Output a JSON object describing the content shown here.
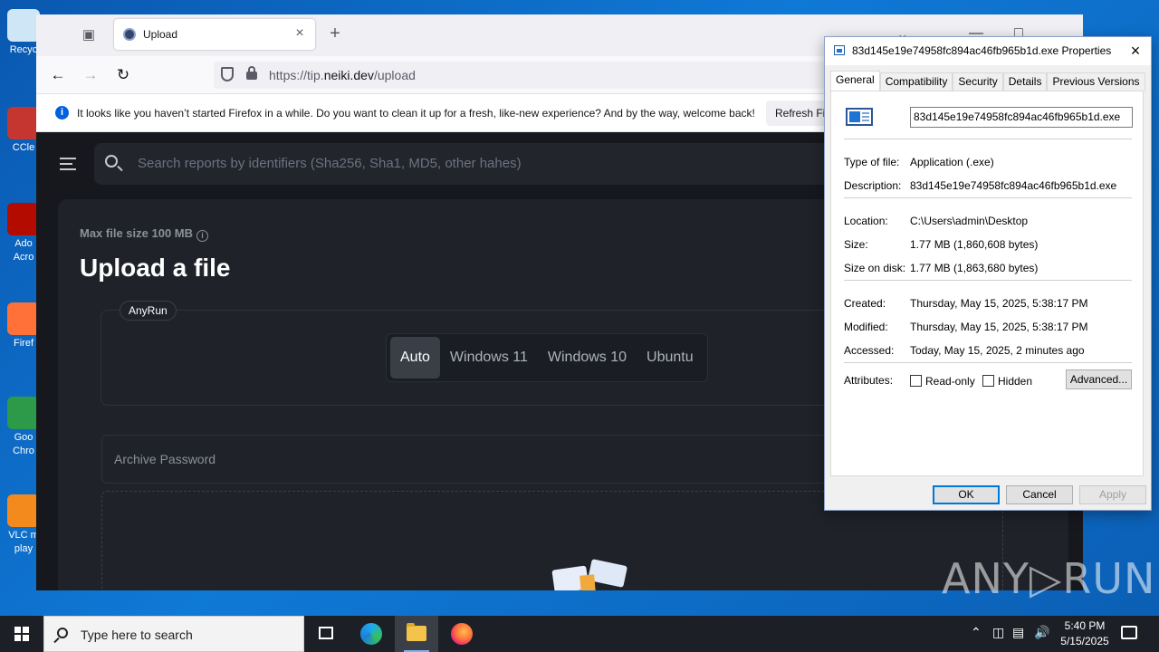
{
  "desktop": {
    "icons": [
      {
        "label": "Recyc",
        "color": "#cfe6f7"
      },
      {
        "label": "CCle",
        "color": "#c4362f"
      },
      {
        "label": "Ado\nAcro",
        "color": "#b30b00"
      },
      {
        "label": "Firef",
        "color": "#ff7139"
      },
      {
        "label": "Goo\nChro",
        "color": "#2c9a48"
      },
      {
        "label": "VLC m\nplay",
        "color": "#f28a1e"
      }
    ],
    "watermark": "ANY▷RUN"
  },
  "browser": {
    "tab_title": "Upload",
    "url_prefix": "https://tip.",
    "url_domain": "neiki.dev",
    "url_path": "/upload",
    "notification": "It looks like you haven’t started Firefox in a while. Do you want to clean it up for a fresh, like-new experience? And by the way, welcome back!",
    "refresh_button": "Refresh Fi"
  },
  "page": {
    "search_placeholder": "Search reports by identifiers (Sha256, Sha1, MD5, other hahes)",
    "max_size": "Max file size 100 MB",
    "heading": "Upload a file",
    "sandbox_badge": "AnyRun",
    "os_options": [
      {
        "label": "Auto",
        "active": true
      },
      {
        "label": "Windows 11",
        "active": false
      },
      {
        "label": "Windows 10",
        "active": false
      },
      {
        "label": "Ubuntu",
        "active": false
      }
    ],
    "password_placeholder": "Archive Password"
  },
  "dialog": {
    "title": "83d145e19e74958fc894ac46fb965b1d.exe Properties",
    "tabs": [
      {
        "label": "General",
        "active": true
      },
      {
        "label": "Compatibility",
        "active": false
      },
      {
        "label": "Security",
        "active": false
      },
      {
        "label": "Details",
        "active": false
      },
      {
        "label": "Previous Versions",
        "active": false
      }
    ],
    "filename": "83d145e19e74958fc894ac46fb965b1d.exe",
    "type_label": "Type of file:",
    "type_value": "Application (.exe)",
    "desc_label": "Description:",
    "desc_value": "83d145e19e74958fc894ac46fb965b1d.exe",
    "location_label": "Location:",
    "location_value": "C:\\Users\\admin\\Desktop",
    "size_label": "Size:",
    "size_value": "1.77 MB (1,860,608 bytes)",
    "sizeondisk_label": "Size on disk:",
    "sizeondisk_value": "1.77 MB (1,863,680 bytes)",
    "created_label": "Created:",
    "created_value": "Thursday, May 15, 2025, 5:38:17 PM",
    "modified_label": "Modified:",
    "modified_value": "Thursday, May 15, 2025, 5:38:17 PM",
    "accessed_label": "Accessed:",
    "accessed_value": "Today, May 15, 2025, 2 minutes ago",
    "attributes_label": "Attributes:",
    "readonly_label": "Read-only",
    "hidden_label": "Hidden",
    "advanced_button": "Advanced...",
    "ok_button": "OK",
    "cancel_button": "Cancel",
    "apply_button": "Apply"
  },
  "taskbar": {
    "search_placeholder": "Type here to search",
    "time": "5:40 PM",
    "date": "5/15/2025"
  }
}
